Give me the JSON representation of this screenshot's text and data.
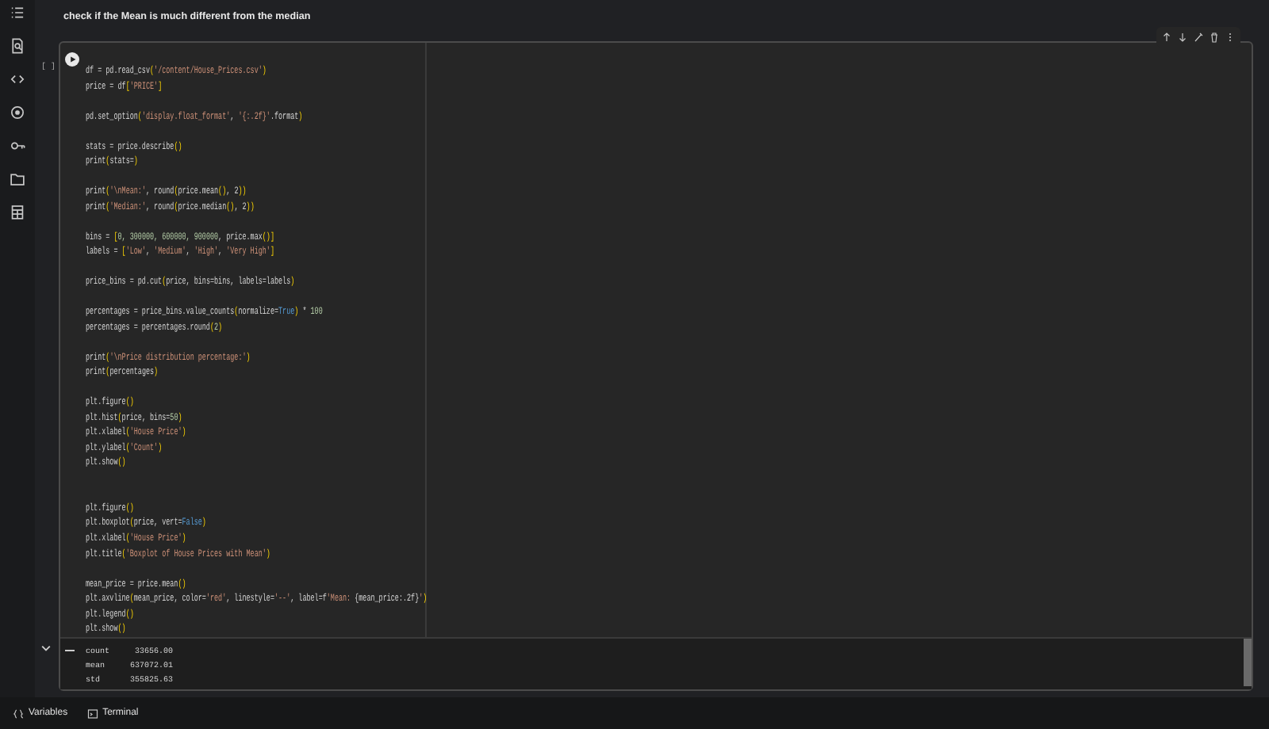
{
  "sidebar": {
    "items": [
      {
        "kind": "toc"
      },
      {
        "kind": "find"
      },
      {
        "kind": "code"
      },
      {
        "kind": "variables"
      },
      {
        "kind": "key"
      },
      {
        "kind": "folder"
      },
      {
        "kind": "table"
      }
    ]
  },
  "text_cell": {
    "text": "check if the Mean is much different from the median"
  },
  "code_cell": {
    "execution_count": "[ ]",
    "toolbar": [
      {
        "kind": "up"
      },
      {
        "kind": "down"
      },
      {
        "kind": "edit"
      },
      {
        "kind": "delete"
      },
      {
        "kind": "more"
      }
    ],
    "lines": [
      {
        "kind": "code",
        "tokens": [
          {
            "kind": "plain",
            "t": "df = pd.read_csv"
          },
          {
            "kind": "bracket",
            "t": "("
          },
          {
            "kind": "string",
            "t": "'/content/House_Prices.csv'"
          },
          {
            "kind": "bracket",
            "t": ")"
          }
        ]
      },
      {
        "kind": "code",
        "tokens": [
          {
            "kind": "plain",
            "t": "price = df"
          },
          {
            "kind": "bracket",
            "t": "["
          },
          {
            "kind": "string",
            "t": "'PRICE'"
          },
          {
            "kind": "bracket",
            "t": "]"
          }
        ]
      },
      {
        "kind": "blank"
      },
      {
        "kind": "code",
        "tokens": [
          {
            "kind": "plain",
            "t": "pd.set_option"
          },
          {
            "kind": "bracket",
            "t": "("
          },
          {
            "kind": "string",
            "t": "'display.float_format'"
          },
          {
            "kind": "plain",
            "t": ", "
          },
          {
            "kind": "string",
            "t": "'{:.2f}'"
          },
          {
            "kind": "plain",
            "t": ".format"
          },
          {
            "kind": "bracket",
            "t": ")"
          }
        ]
      },
      {
        "kind": "blank"
      },
      {
        "kind": "code",
        "tokens": [
          {
            "kind": "plain",
            "t": "stats = price.describe"
          },
          {
            "kind": "bracket",
            "t": "()"
          }
        ]
      },
      {
        "kind": "code",
        "tokens": [
          {
            "kind": "plain",
            "t": "print"
          },
          {
            "kind": "bracket",
            "t": "("
          },
          {
            "kind": "plain",
            "t": "stats="
          },
          {
            "kind": "bracket",
            "t": ")"
          }
        ]
      },
      {
        "kind": "blank"
      },
      {
        "kind": "code",
        "tokens": [
          {
            "kind": "plain",
            "t": "print"
          },
          {
            "kind": "bracket",
            "t": "("
          },
          {
            "kind": "string",
            "t": "'\\nMean:'"
          },
          {
            "kind": "plain",
            "t": ", round"
          },
          {
            "kind": "bracket",
            "t": "("
          },
          {
            "kind": "plain",
            "t": "price.mean"
          },
          {
            "kind": "bracket",
            "t": "()"
          },
          {
            "kind": "plain",
            "t": ", 2"
          },
          {
            "kind": "bracket",
            "t": "))"
          }
        ]
      },
      {
        "kind": "code",
        "tokens": [
          {
            "kind": "plain",
            "t": "print"
          },
          {
            "kind": "bracket",
            "t": "("
          },
          {
            "kind": "string",
            "t": "'Median:'"
          },
          {
            "kind": "plain",
            "t": ", round"
          },
          {
            "kind": "bracket",
            "t": "("
          },
          {
            "kind": "plain",
            "t": "price.median"
          },
          {
            "kind": "bracket",
            "t": "()"
          },
          {
            "kind": "plain",
            "t": ", 2"
          },
          {
            "kind": "bracket",
            "t": "))"
          }
        ]
      },
      {
        "kind": "blank"
      },
      {
        "kind": "code",
        "tokens": [
          {
            "kind": "plain",
            "t": "bins = "
          },
          {
            "kind": "bracket",
            "t": "["
          },
          {
            "kind": "number",
            "t": "0, 300000, 600000, 900000"
          },
          {
            "kind": "plain",
            "t": ", price.max"
          },
          {
            "kind": "bracket",
            "t": "()]"
          }
        ]
      },
      {
        "kind": "code",
        "tokens": [
          {
            "kind": "plain",
            "t": "labels = "
          },
          {
            "kind": "bracket",
            "t": "["
          },
          {
            "kind": "string",
            "t": "'Low'"
          },
          {
            "kind": "plain",
            "t": ", "
          },
          {
            "kind": "string",
            "t": "'Medium'"
          },
          {
            "kind": "plain",
            "t": ", "
          },
          {
            "kind": "string",
            "t": "'High'"
          },
          {
            "kind": "plain",
            "t": ", "
          },
          {
            "kind": "string",
            "t": "'Very High'"
          },
          {
            "kind": "bracket",
            "t": "]"
          }
        ]
      },
      {
        "kind": "blank"
      },
      {
        "kind": "code",
        "tokens": [
          {
            "kind": "plain",
            "t": "price_bins = pd.cut"
          },
          {
            "kind": "bracket",
            "t": "("
          },
          {
            "kind": "plain",
            "t": "price, bins=bins, labels=labels"
          },
          {
            "kind": "bracket",
            "t": ")"
          }
        ]
      },
      {
        "kind": "blank"
      },
      {
        "kind": "code",
        "tokens": [
          {
            "kind": "plain",
            "t": "percentages = price_bins.value_counts"
          },
          {
            "kind": "bracket",
            "t": "("
          },
          {
            "kind": "plain",
            "t": "normalize="
          },
          {
            "kind": "keyword",
            "t": "True"
          },
          {
            "kind": "bracket",
            "t": ")"
          },
          {
            "kind": "plain",
            "t": " * "
          },
          {
            "kind": "number",
            "t": "100"
          }
        ]
      },
      {
        "kind": "code",
        "tokens": [
          {
            "kind": "plain",
            "t": "percentages = percentages.round"
          },
          {
            "kind": "bracket",
            "t": "("
          },
          {
            "kind": "number",
            "t": "2"
          },
          {
            "kind": "bracket",
            "t": ")"
          }
        ]
      },
      {
        "kind": "blank"
      },
      {
        "kind": "code",
        "tokens": [
          {
            "kind": "plain",
            "t": "print"
          },
          {
            "kind": "bracket",
            "t": "("
          },
          {
            "kind": "string",
            "t": "'\\nPrice distribution percentage:'"
          },
          {
            "kind": "bracket",
            "t": ")"
          }
        ]
      },
      {
        "kind": "code",
        "tokens": [
          {
            "kind": "plain",
            "t": "print"
          },
          {
            "kind": "bracket",
            "t": "("
          },
          {
            "kind": "plain",
            "t": "percentages"
          },
          {
            "kind": "bracket",
            "t": ")"
          }
        ]
      },
      {
        "kind": "blank"
      },
      {
        "kind": "code",
        "tokens": [
          {
            "kind": "plain",
            "t": "plt.figure"
          },
          {
            "kind": "bracket",
            "t": "()"
          }
        ]
      },
      {
        "kind": "code",
        "tokens": [
          {
            "kind": "plain",
            "t": "plt.hist"
          },
          {
            "kind": "bracket",
            "t": "("
          },
          {
            "kind": "plain",
            "t": "price, bins="
          },
          {
            "kind": "number",
            "t": "50"
          },
          {
            "kind": "bracket",
            "t": ")"
          }
        ]
      },
      {
        "kind": "code",
        "tokens": [
          {
            "kind": "plain",
            "t": "plt.xlabel"
          },
          {
            "kind": "bracket",
            "t": "("
          },
          {
            "kind": "string",
            "t": "'House Price'"
          },
          {
            "kind": "bracket",
            "t": ")"
          }
        ]
      },
      {
        "kind": "code",
        "tokens": [
          {
            "kind": "plain",
            "t": "plt.ylabel"
          },
          {
            "kind": "bracket",
            "t": "("
          },
          {
            "kind": "string",
            "t": "'Count'"
          },
          {
            "kind": "bracket",
            "t": ")"
          }
        ]
      },
      {
        "kind": "code",
        "tokens": [
          {
            "kind": "plain",
            "t": "plt.show"
          },
          {
            "kind": "bracket",
            "t": "()"
          }
        ]
      },
      {
        "kind": "blank"
      },
      {
        "kind": "blank"
      },
      {
        "kind": "code",
        "tokens": [
          {
            "kind": "plain",
            "t": "plt.figure"
          },
          {
            "kind": "bracket",
            "t": "()"
          }
        ]
      },
      {
        "kind": "code",
        "tokens": [
          {
            "kind": "plain",
            "t": "plt.boxplot"
          },
          {
            "kind": "bracket",
            "t": "("
          },
          {
            "kind": "plain",
            "t": "price, vert="
          },
          {
            "kind": "keyword",
            "t": "False"
          },
          {
            "kind": "bracket",
            "t": ")"
          }
        ]
      },
      {
        "kind": "code",
        "tokens": [
          {
            "kind": "plain",
            "t": "plt.xlabel"
          },
          {
            "kind": "bracket",
            "t": "("
          },
          {
            "kind": "string",
            "t": "'House Price'"
          },
          {
            "kind": "bracket",
            "t": ")"
          }
        ]
      },
      {
        "kind": "code",
        "tokens": [
          {
            "kind": "plain",
            "t": "plt.title"
          },
          {
            "kind": "bracket",
            "t": "("
          },
          {
            "kind": "string",
            "t": "'Boxplot of House Prices with Mean'"
          },
          {
            "kind": "bracket",
            "t": ")"
          }
        ]
      },
      {
        "kind": "blank"
      },
      {
        "kind": "code",
        "tokens": [
          {
            "kind": "plain",
            "t": "mean_price = price.mean"
          },
          {
            "kind": "bracket",
            "t": "()"
          }
        ]
      },
      {
        "kind": "code",
        "tokens": [
          {
            "kind": "plain",
            "t": "plt.axvline"
          },
          {
            "kind": "bracket",
            "t": "("
          },
          {
            "kind": "plain",
            "t": "mean_price, color="
          },
          {
            "kind": "string",
            "t": "'red'"
          },
          {
            "kind": "plain",
            "t": ", linestyle="
          },
          {
            "kind": "string",
            "t": "'--'"
          },
          {
            "kind": "plain",
            "t": ", label=f"
          },
          {
            "kind": "string",
            "t": "'Mean: "
          },
          {
            "kind": "plain",
            "t": "{mean_price:.2f}"
          },
          {
            "kind": "string",
            "t": "'"
          },
          {
            "kind": "bracket",
            "t": ")"
          }
        ]
      },
      {
        "kind": "code",
        "tokens": [
          {
            "kind": "plain",
            "t": "plt.legend"
          },
          {
            "kind": "bracket",
            "t": "()"
          }
        ]
      },
      {
        "kind": "code",
        "tokens": [
          {
            "kind": "plain",
            "t": "plt.show"
          },
          {
            "kind": "bracket",
            "t": "()"
          }
        ]
      }
    ],
    "output": {
      "expanded": true,
      "rows": [
        {
          "label": "count",
          "value": "33656.00"
        },
        {
          "label": "mean",
          "value": "637072.01"
        },
        {
          "label": "std",
          "value": "355825.63"
        }
      ]
    }
  },
  "status_bar": {
    "items": [
      {
        "kind": "variables",
        "label": "Variables"
      },
      {
        "kind": "terminal",
        "label": "Terminal"
      }
    ]
  }
}
